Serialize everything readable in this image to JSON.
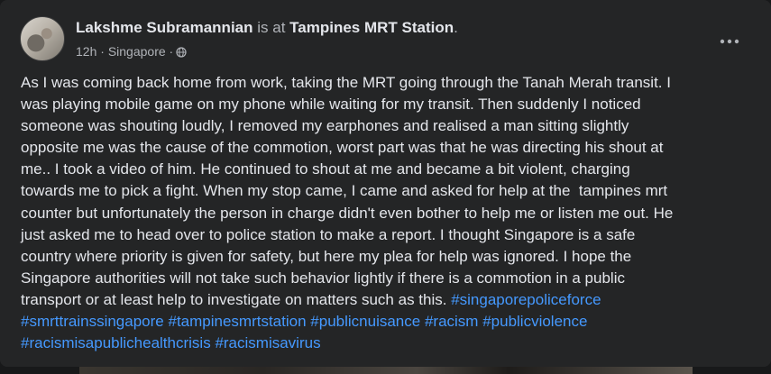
{
  "post": {
    "author": "Lakshme Subramannian",
    "connector": "is at",
    "location": "Tampines MRT Station",
    "period": ".",
    "time": "12h",
    "place": "Singapore",
    "separator": "·",
    "privacy_icon": "globe-icon",
    "more_icon": "more-options-icon",
    "body_lines": [
      "As I was coming back home from work, taking the MRT going through the Tanah Merah transit. I",
      "was playing mobile game on my phone while waiting for my transit. Then suddenly I noticed",
      "someone was shouting loudly, I removed my earphones and realised a man sitting slightly",
      "opposite me was the cause of the commotion, worst part was that he was directing his shout at",
      "me.. I took a video of him. He continued to shout at me and became a bit violent, charging",
      "towards me to pick a fight. When my stop came, I came and asked for help at the  tampines mrt",
      "counter but unfortunately the person in charge didn't even bother to help me or listen me out. He",
      "just asked me to head over to police station to make a report. I thought Singapore is a safe",
      "country where priority is given for safety, but here my plea for help was ignored. I hope the",
      "Singapore authorities will not take such behavior lightly if there is a commotion in a public",
      "transport or at least help to investigate on matters such as this. "
    ],
    "hashtags": [
      "#singaporepoliceforce",
      "#smrttrainssingapore",
      "#tampinesmrtstation",
      "#publicnuisance",
      "#racism",
      "#publicviolence",
      "#racismisapublichealthcrisis",
      "#racismisavirus"
    ]
  },
  "colors": {
    "card_bg": "#242526",
    "text_primary": "#e4e6eb",
    "text_secondary": "#b0b3b8",
    "hashtag": "#4599ff"
  }
}
